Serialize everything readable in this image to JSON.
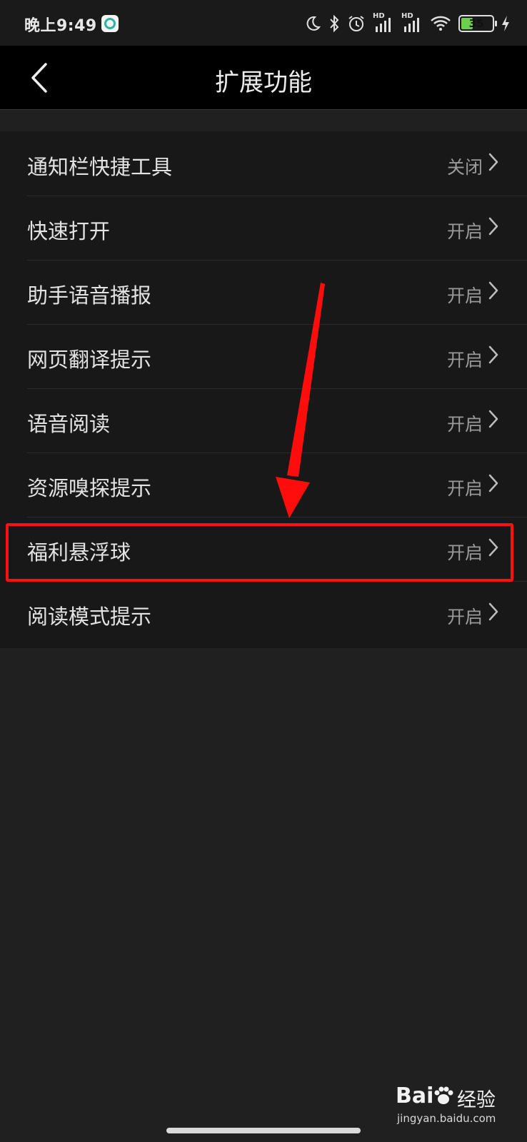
{
  "status_bar": {
    "time": "晚上9:49",
    "battery": "35",
    "battery_level": 0.35,
    "network": [
      "HD",
      "HD"
    ],
    "icons": [
      "app-badge-icon",
      "moon-icon",
      "bluetooth-icon",
      "alarm-icon",
      "signal-icon",
      "signal-icon",
      "wifi-icon",
      "battery-icon",
      "charging-icon"
    ]
  },
  "header": {
    "title": "扩展功能",
    "back_icon": "chevron-left-icon"
  },
  "settings": [
    {
      "label": "通知栏快捷工具",
      "value": "关闭"
    },
    {
      "label": "快速打开",
      "value": "开启"
    },
    {
      "label": "助手语音播报",
      "value": "开启"
    },
    {
      "label": "网页翻译提示",
      "value": "开启"
    },
    {
      "label": "语音阅读",
      "value": "开启"
    },
    {
      "label": "资源嗅探提示",
      "value": "开启"
    },
    {
      "label": "福利悬浮球",
      "value": "开启"
    },
    {
      "label": "阅读模式提示",
      "value": "开启"
    }
  ],
  "annotation": {
    "highlighted_item": "福利悬浮球",
    "color": "#ff1010"
  },
  "watermark": {
    "brand": "Bai",
    "brand_suffix": "经验",
    "url": "jingyan.baidu.com"
  },
  "colors": {
    "background": "#202020",
    "header_bg": "#000000",
    "list_bg": "#181818",
    "text": "#e3e3e3",
    "value_text": "#9a9a9a",
    "battery_fill": "#6ccf4d"
  }
}
